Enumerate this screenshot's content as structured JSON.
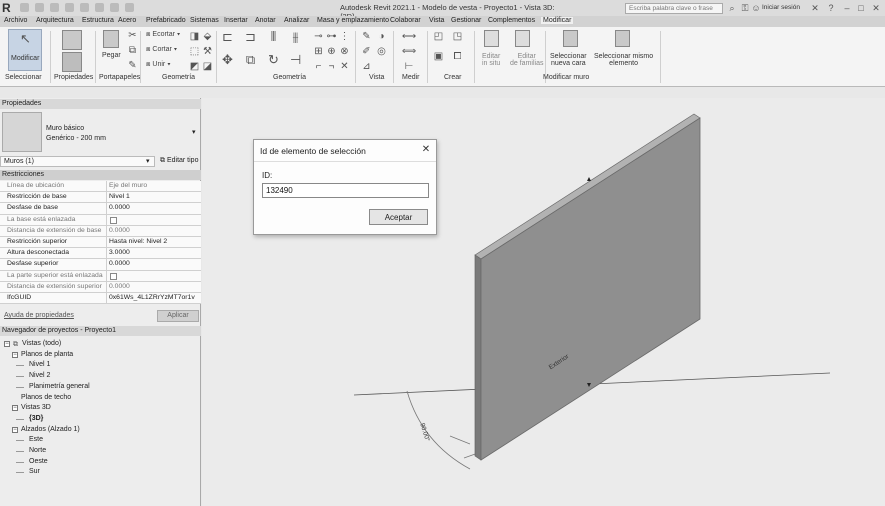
{
  "app": {
    "logo": "R",
    "title": "Autodesk Revit 2021.1 - Modelo de vesta - Proyecto1 - Vista 3D: {3D}",
    "search_placeholder": "Escriba palabra clave o frase",
    "signin": "Iniciar sesión"
  },
  "menu": {
    "tabs": [
      "Archivo",
      "Arquitectura",
      "Estructura",
      "Acero",
      "Prefabricado",
      "Sistemas",
      "Insertar",
      "Anotar",
      "Analizar",
      "Masa y emplazamiento",
      "Colaborar",
      "Vista",
      "Gestionar",
      "Complementos",
      "Modificar"
    ],
    "active": "Modificar"
  },
  "ribbon": {
    "modify_label": "Modificar",
    "select_group": "Seleccionar",
    "properties_group": "Propiedades",
    "clipboard_group": "Portapapeles",
    "paste_label": "Pegar",
    "geometry_group": "Geometría",
    "cope_label": "Ecortar",
    "cut_label": "Cortar",
    "join_label": "Unir",
    "modify_group": "Geometría",
    "view_group": "Vista",
    "measure_group": "Medir",
    "create_group": "Crear",
    "edit_inplace": "Editar\nin situ",
    "edit_families": "Editar\nde familias",
    "select_new_face": "Seleccionar\nnueva cara",
    "select_same": "Seleccionar mismo\nelemento",
    "modify_wall_group": "Modificar muro"
  },
  "properties": {
    "header": "Propiedades",
    "type_name": "Muro básico",
    "type_sub": "Genérico - 200 mm",
    "selector": "Muros (1)",
    "edit_type": "Editar tipo",
    "section": "Restricciones",
    "rows": [
      {
        "k": "Línea de ubicación",
        "v": "Eje del muro",
        "dim": true
      },
      {
        "k": "Restricción de base",
        "v": "Nivel 1",
        "dim": false
      },
      {
        "k": "Desfase de base",
        "v": "0.0000",
        "dim": false
      },
      {
        "k": "La base está enlazada",
        "v": "",
        "dim": true,
        "check": true
      },
      {
        "k": "Distancia de extensión de base",
        "v": "0.0000",
        "dim": true
      },
      {
        "k": "Restricción superior",
        "v": "Hasta nivel: Nivel 2",
        "dim": false
      },
      {
        "k": "Altura desconectada",
        "v": "3.0000",
        "dim": false
      },
      {
        "k": "Desfase superior",
        "v": "0.0000",
        "dim": false
      },
      {
        "k": "La parte superior está enlazada",
        "v": "",
        "dim": true,
        "check": true
      },
      {
        "k": "Distancia de extensión superior",
        "v": "0.0000",
        "dim": true
      },
      {
        "k": "IfcGUID",
        "v": "0x61Ws_4L1ZRrYzMT7or1v",
        "dim": false
      }
    ],
    "help": "Ayuda de propiedades",
    "apply": "Aplicar"
  },
  "browser": {
    "header": "Navegador de proyectos - Proyecto1",
    "items": [
      {
        "label": "Vistas (todo)",
        "level": 0,
        "sign": "−",
        "icon": true
      },
      {
        "label": "Planos de planta",
        "level": 1,
        "sign": "−"
      },
      {
        "label": "Nivel 1",
        "level": 2
      },
      {
        "label": "Nivel 2",
        "level": 2
      },
      {
        "label": "Planimetría general",
        "level": 2
      },
      {
        "label": "Planos de techo",
        "level": 1
      },
      {
        "label": "Vistas 3D",
        "level": 1,
        "sign": "−"
      },
      {
        "label": "{3D}",
        "level": 2,
        "bold": true
      },
      {
        "label": "Alzados (Alzado 1)",
        "level": 1,
        "sign": "−"
      },
      {
        "label": "Este",
        "level": 2
      },
      {
        "label": "Norte",
        "level": 2
      },
      {
        "label": "Oeste",
        "level": 2
      },
      {
        "label": "Sur",
        "level": 2
      }
    ]
  },
  "dialog": {
    "title": "Id de elemento de selección",
    "id_label": "ID:",
    "id_value": "132490",
    "ok_label": "Aceptar",
    "close_glyph": "✕"
  },
  "viewport": {
    "wall_tag": "Exterior",
    "angle": "90.00°"
  },
  "colors": {
    "wall_face": "#8f8f8f",
    "wall_edge": "#6a6a6a",
    "canvas": "#ebebeb"
  }
}
